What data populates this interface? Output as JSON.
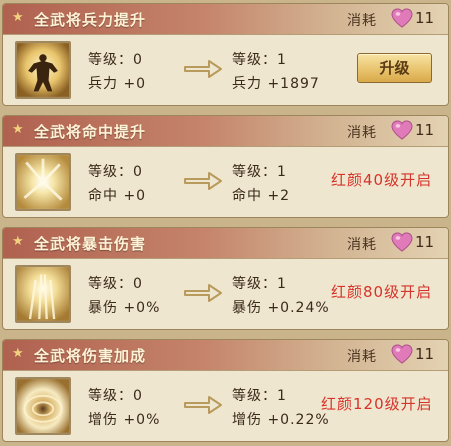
{
  "cards": [
    {
      "title": "全武将兵力提升",
      "cost_label": "消耗",
      "cost_value": "11",
      "cur_level": "等级：0",
      "cur_attr": "兵力 +0",
      "next_level": "等级：1",
      "next_attr": "兵力 +1897",
      "button_label": "升级"
    },
    {
      "title": "全武将命中提升",
      "cost_label": "消耗",
      "cost_value": "11",
      "cur_level": "等级：0",
      "cur_attr": "命中 +0",
      "next_level": "等级：1",
      "next_attr": "命中 +2",
      "status": "红颜40级开启"
    },
    {
      "title": "全武将暴击伤害",
      "cost_label": "消耗",
      "cost_value": "11",
      "cur_level": "等级：0",
      "cur_attr": "暴伤 +0%",
      "next_level": "等级：1",
      "next_attr": "暴伤 +0.24%",
      "status": "红颜80级开启"
    },
    {
      "title": "全武将伤害加成",
      "cost_label": "消耗",
      "cost_value": "11",
      "cur_level": "等级：0",
      "cur_attr": "增伤 +0%",
      "next_level": "等级：1",
      "next_attr": "增伤 +0.22%",
      "status": "红颜120级开启"
    }
  ],
  "icons": {
    "header_star": "star-icon",
    "cost": "heart-icon",
    "arrow": "arrow-right-icon",
    "skill_1": "warrior-power-icon",
    "skill_2": "light-burst-icon",
    "skill_3": "critical-flare-icon",
    "skill_4": "vortex-icon"
  },
  "colors": {
    "header_red": "#b0614f",
    "status_red": "#d6332a",
    "heart_pink": "#e07ab8",
    "button_gold": "#e9c46f"
  }
}
